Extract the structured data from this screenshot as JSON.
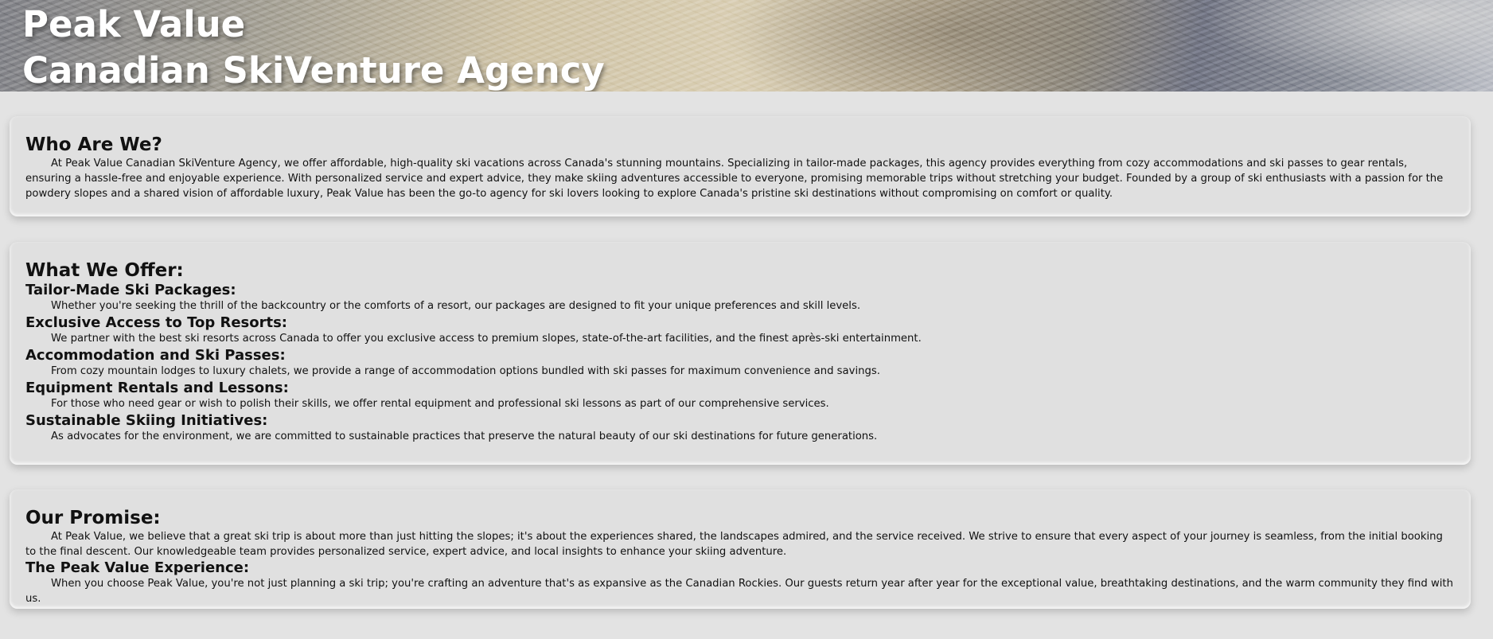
{
  "header": {
    "title_line1": "Peak Value",
    "title_line2": "Canadian SkiVenture Agency"
  },
  "who": {
    "heading": "Who Are We?",
    "body": "At Peak Value Canadian SkiVenture Agency, we offer affordable, high-quality ski vacations across Canada's stunning mountains. Specializing in tailor-made packages, this agency provides everything from cozy accommodations and ski passes to gear rentals, ensuring a hassle-free and enjoyable experience. With personalized service and expert advice, they make skiing adventures accessible to everyone, promising memorable trips without stretching your budget. Founded by a group of ski enthusiasts with a passion for the powdery slopes and a shared vision of affordable luxury, Peak Value has been the go-to agency for ski lovers looking to explore Canada's pristine ski destinations without compromising on comfort or quality."
  },
  "offer": {
    "heading": "What We Offer:",
    "items": [
      {
        "title": "Tailor-Made Ski Packages:",
        "body": "Whether you're seeking the thrill of the backcountry or the comforts of a resort, our packages are designed to fit your unique preferences and skill levels."
      },
      {
        "title": "Exclusive Access to Top Resorts:",
        "body": "We partner with the best ski resorts across Canada to offer you exclusive access to premium slopes, state-of-the-art facilities, and the finest après-ski entertainment."
      },
      {
        "title": "Accommodation and Ski Passes:",
        "body": "From cozy mountain lodges to luxury chalets, we provide a range of accommodation options bundled with ski passes for maximum convenience and savings."
      },
      {
        "title": "Equipment Rentals and Lessons:",
        "body": "For those who need gear or wish to polish their skills, we offer rental equipment and professional ski lessons as part of our comprehensive services."
      },
      {
        "title": "Sustainable Skiing Initiatives:",
        "body": "As advocates for the environment, we are committed to sustainable practices that preserve the natural beauty of our ski destinations for future generations."
      }
    ]
  },
  "promise": {
    "heading": "Our Promise:",
    "body": "At Peak Value, we believe that a great ski trip is about more than just hitting the slopes; it's about the experiences shared, the landscapes admired, and the service received. We strive to ensure that every aspect of your journey is seamless, from the initial booking to the final descent. Our knowledgeable team provides personalized service, expert advice, and local insights to enhance your skiing adventure.",
    "experience_title": "The Peak Value Experience:",
    "experience_body": "When you choose Peak Value, you're not just planning a ski trip; you're crafting an adventure that's as expansive as the Canadian Rockies. Our guests return year after year for the exceptional value, breathtaking destinations, and the warm community they find with us."
  }
}
